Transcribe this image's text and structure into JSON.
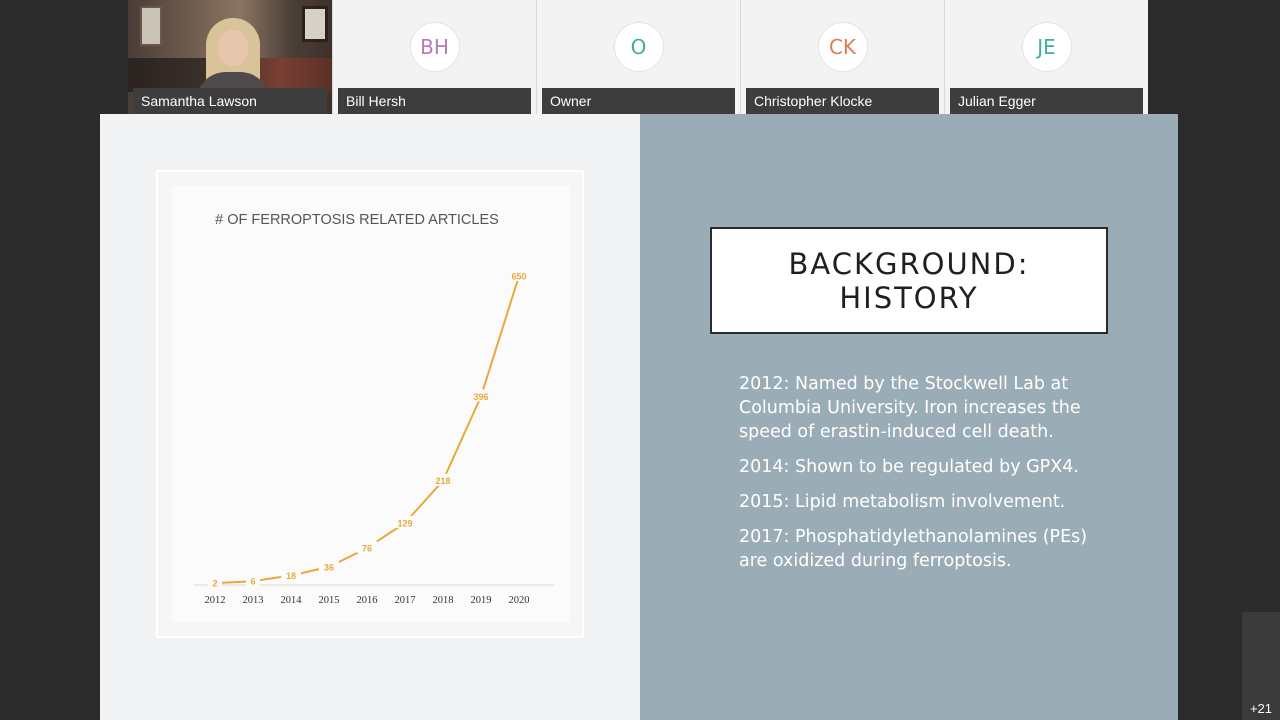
{
  "participants": [
    {
      "name": "Samantha Lawson",
      "video": true
    },
    {
      "name": "Bill Hersh",
      "initials": "BH",
      "color": "#b879b8"
    },
    {
      "name": "Owner",
      "initials": "O",
      "color": "#3fae9d"
    },
    {
      "name": "Christopher Klocke",
      "initials": "CK",
      "color": "#e07a4f"
    },
    {
      "name": "Julian Egger",
      "initials": "JE",
      "color": "#3fae9d"
    }
  ],
  "more_participants": "+21",
  "slide": {
    "heading_line1": "BACKGROUND:",
    "heading_line2": "HISTORY",
    "history": [
      "2012: Named by the Stockwell Lab at Columbia University. Iron increases the speed of erastin-induced cell death.",
      "2014: Shown to be regulated by GPX4.",
      "2015: Lipid metabolism involvement.",
      "2017: Phosphatidylethanolamines (PEs) are oxidized during ferroptosis."
    ]
  },
  "chart_data": {
    "type": "line",
    "title": "# OF FERROPTOSIS RELATED ARTICLES",
    "categories": [
      "2012",
      "2013",
      "2014",
      "2015",
      "2016",
      "2017",
      "2018",
      "2019",
      "2020"
    ],
    "values": [
      2,
      6,
      18,
      36,
      76,
      129,
      218,
      396,
      650
    ],
    "data_labels": [
      "2",
      "6",
      "18",
      "36",
      "76",
      "129",
      "218",
      "396",
      "650"
    ],
    "ylim": [
      0,
      700
    ],
    "grid": false,
    "line_color": "#e8a93a"
  }
}
